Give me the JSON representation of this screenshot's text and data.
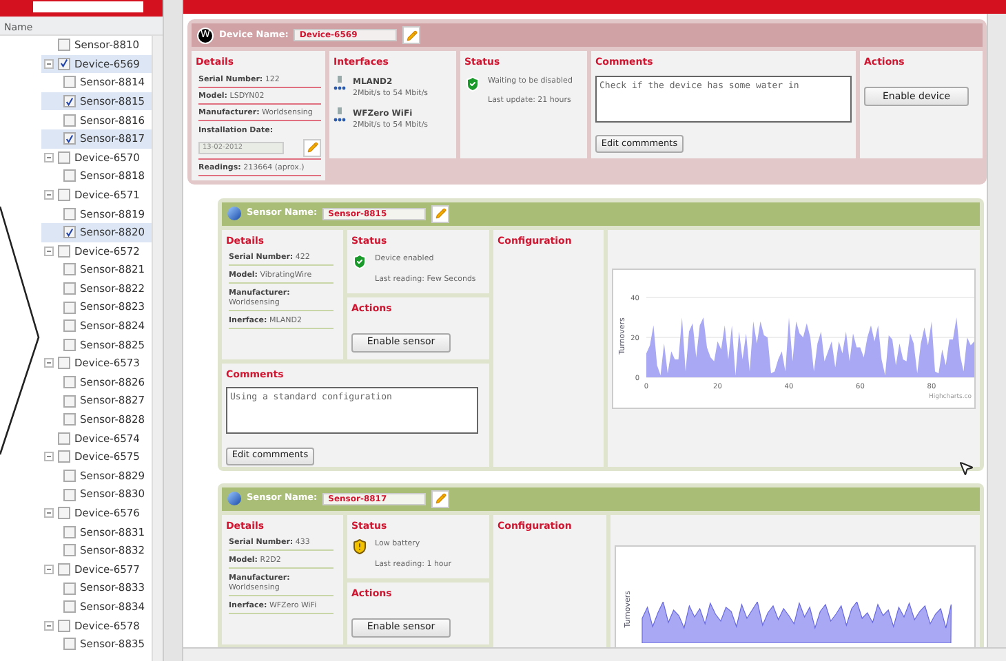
{
  "tree": {
    "header": "Name",
    "items": [
      {
        "label": "Sensor-8810",
        "checked": false,
        "selected": false
      },
      {
        "label": "Device-6569",
        "checked": true,
        "selected": true,
        "expanded": true,
        "children": [
          {
            "label": "Sensor-8814",
            "checked": false,
            "selected": false
          },
          {
            "label": "Sensor-8815",
            "checked": true,
            "selected": true
          },
          {
            "label": "Sensor-8816",
            "checked": false,
            "selected": false
          },
          {
            "label": "Sensor-8817",
            "checked": true,
            "selected": true
          }
        ]
      },
      {
        "label": "Device-6570",
        "checked": false,
        "selected": false,
        "expanded": true,
        "children": [
          {
            "label": "Sensor-8818",
            "checked": false,
            "selected": false
          }
        ]
      },
      {
        "label": "Device-6571",
        "checked": false,
        "selected": false,
        "expanded": true,
        "children": [
          {
            "label": "Sensor-8819",
            "checked": false,
            "selected": false
          },
          {
            "label": "Sensor-8820",
            "checked": true,
            "selected": true
          }
        ]
      },
      {
        "label": "Device-6572",
        "checked": false,
        "selected": false,
        "expanded": true,
        "children": [
          {
            "label": "Sensor-8821",
            "checked": false,
            "selected": false
          },
          {
            "label": "Sensor-8822",
            "checked": false,
            "selected": false
          },
          {
            "label": "Sensor-8823",
            "checked": false,
            "selected": false
          },
          {
            "label": "Sensor-8824",
            "checked": false,
            "selected": false
          },
          {
            "label": "Sensor-8825",
            "checked": false,
            "selected": false
          }
        ]
      },
      {
        "label": "Device-6573",
        "checked": false,
        "selected": false,
        "expanded": true,
        "children": [
          {
            "label": "Sensor-8826",
            "checked": false,
            "selected": false
          },
          {
            "label": "Sensor-8827",
            "checked": false,
            "selected": false
          },
          {
            "label": "Sensor-8828",
            "checked": false,
            "selected": false
          }
        ]
      },
      {
        "label": "Device-6574",
        "checked": false,
        "selected": false
      },
      {
        "label": "Device-6575",
        "checked": false,
        "selected": false,
        "expanded": true,
        "children": [
          {
            "label": "Sensor-8829",
            "checked": false,
            "selected": false
          },
          {
            "label": "Sensor-8830",
            "checked": false,
            "selected": false
          }
        ]
      },
      {
        "label": "Device-6576",
        "checked": false,
        "selected": false,
        "expanded": true,
        "children": [
          {
            "label": "Sensor-8831",
            "checked": false,
            "selected": false
          },
          {
            "label": "Sensor-8832",
            "checked": false,
            "selected": false
          }
        ]
      },
      {
        "label": "Device-6577",
        "checked": false,
        "selected": false,
        "expanded": true,
        "children": [
          {
            "label": "Sensor-8833",
            "checked": false,
            "selected": false
          },
          {
            "label": "Sensor-8834",
            "checked": false,
            "selected": false
          }
        ]
      },
      {
        "label": "Device-6578",
        "checked": false,
        "selected": false,
        "expanded": true,
        "children": [
          {
            "label": "Sensor-8835",
            "checked": false,
            "selected": false
          }
        ]
      }
    ]
  },
  "device": {
    "logo": "W",
    "name_label": "Device Name:",
    "name": "Device-6569",
    "details": {
      "title": "Details",
      "fields": [
        {
          "label": "Serial Number:",
          "value": "122"
        },
        {
          "label": "Model:",
          "value": "LSDYN02"
        },
        {
          "label": "Manufacturer:",
          "value": "Worldsensing"
        }
      ],
      "date_label": "Installation Date:",
      "date": "13-02-2012",
      "readings_label": "Readings:",
      "readings": "213664 (aprox.)"
    },
    "interfaces": {
      "title": "Interfaces",
      "items": [
        {
          "name": "MLAND2",
          "speed": "2Mbit/s to 54 Mbit/s"
        },
        {
          "name": "WFZero WiFi",
          "speed": "2Mbit/s to 54 Mbit/s"
        }
      ]
    },
    "status": {
      "title": "Status",
      "kind": "ok",
      "text": "Waiting to be disabled",
      "update": "Last update: 21 hours"
    },
    "comments": {
      "title": "Comments",
      "value": "Check if the device has some water in",
      "button": "Edit commments"
    },
    "actions": {
      "title": "Actions",
      "button": "Enable device"
    }
  },
  "sensors": [
    {
      "name_label": "Sensor Name:",
      "name": "Sensor-8815",
      "details_title": "Details",
      "fields": [
        {
          "label": "Serial Number:",
          "value": "422"
        },
        {
          "label": "Model:",
          "value": "VibratingWire"
        },
        {
          "label": "Manufacturer:",
          "value": "Worldsensing"
        },
        {
          "label": "Inerface:",
          "value": "MLAND2"
        }
      ],
      "status": {
        "title": "Status",
        "kind": "ok",
        "text": "Device enabled",
        "update": "Last reading: Few Seconds"
      },
      "actions_title": "Actions",
      "action_button": "Enable sensor",
      "comments": {
        "title": "Comments",
        "value": "Using a standard configuration",
        "button": "Edit commments"
      },
      "config_title": "Configuration",
      "chart": {
        "credit": "Highcharts.co",
        "chart_data": {
          "type": "area",
          "ylabel": "Turnovers",
          "xlim": [
            0,
            92
          ],
          "ylim": [
            0,
            40
          ],
          "xticks": [
            0,
            20,
            40,
            60,
            80
          ],
          "yticks": [
            0,
            20,
            40
          ],
          "x": [
            0,
            1,
            2,
            3,
            4,
            5,
            6,
            7,
            8,
            9,
            10,
            11,
            12,
            13,
            14,
            15,
            16,
            17,
            18,
            19,
            20,
            21,
            22,
            23,
            24,
            25,
            26,
            27,
            28,
            29,
            30,
            31,
            32,
            33,
            34,
            35,
            36,
            37,
            38,
            39,
            40,
            41,
            42,
            43,
            44,
            45,
            46,
            47,
            48,
            49,
            50,
            51,
            52,
            53,
            54,
            55,
            56,
            57,
            58,
            59,
            60,
            61,
            62,
            63,
            64,
            65,
            66,
            67,
            68,
            69,
            70,
            71,
            72,
            73,
            74,
            75,
            76,
            77,
            78,
            79,
            80,
            81,
            82,
            83,
            84,
            85,
            86,
            87,
            88,
            89,
            90,
            91,
            92
          ],
          "series": [
            {
              "color": "#a8a8f4",
              "values": [
                12,
                16,
                26,
                6,
                1,
                17,
                2,
                13,
                9,
                9,
                30,
                3,
                23,
                27,
                10,
                26,
                30,
                15,
                10,
                8,
                18,
                14,
                26,
                9,
                26,
                1,
                23,
                9,
                22,
                3,
                28,
                17,
                28,
                21,
                20,
                2,
                3,
                9,
                13,
                3,
                30,
                8,
                28,
                22,
                20,
                27,
                20,
                3,
                17,
                23,
                8,
                13,
                18,
                5,
                18,
                12,
                23,
                8,
                22,
                15,
                15,
                10,
                20,
                26,
                18,
                26,
                9,
                1,
                21,
                19,
                6,
                17,
                9,
                8,
                22,
                17,
                2,
                17,
                25,
                16,
                28,
                3,
                2,
                14,
                6,
                19,
                19,
                30,
                11,
                3,
                20,
                16,
                18
              ]
            }
          ]
        }
      }
    },
    {
      "name_label": "Sensor Name:",
      "name": "Sensor-8817",
      "details_title": "Details",
      "fields": [
        {
          "label": "Serial Number:",
          "value": "433"
        },
        {
          "label": "Model:",
          "value": "R2D2"
        },
        {
          "label": "Manufacturer:",
          "value": "Worldsensing"
        },
        {
          "label": "Inerface:",
          "value": "WFZero WiFi"
        }
      ],
      "status": {
        "title": "Status",
        "kind": "warning",
        "text": "Low battery",
        "update": "Last reading: 1 hour"
      },
      "actions_title": "Actions",
      "action_button": "Enable sensor",
      "config_title": "Configuration",
      "chart": {
        "ylabel": "Turnovers"
      }
    }
  ]
}
